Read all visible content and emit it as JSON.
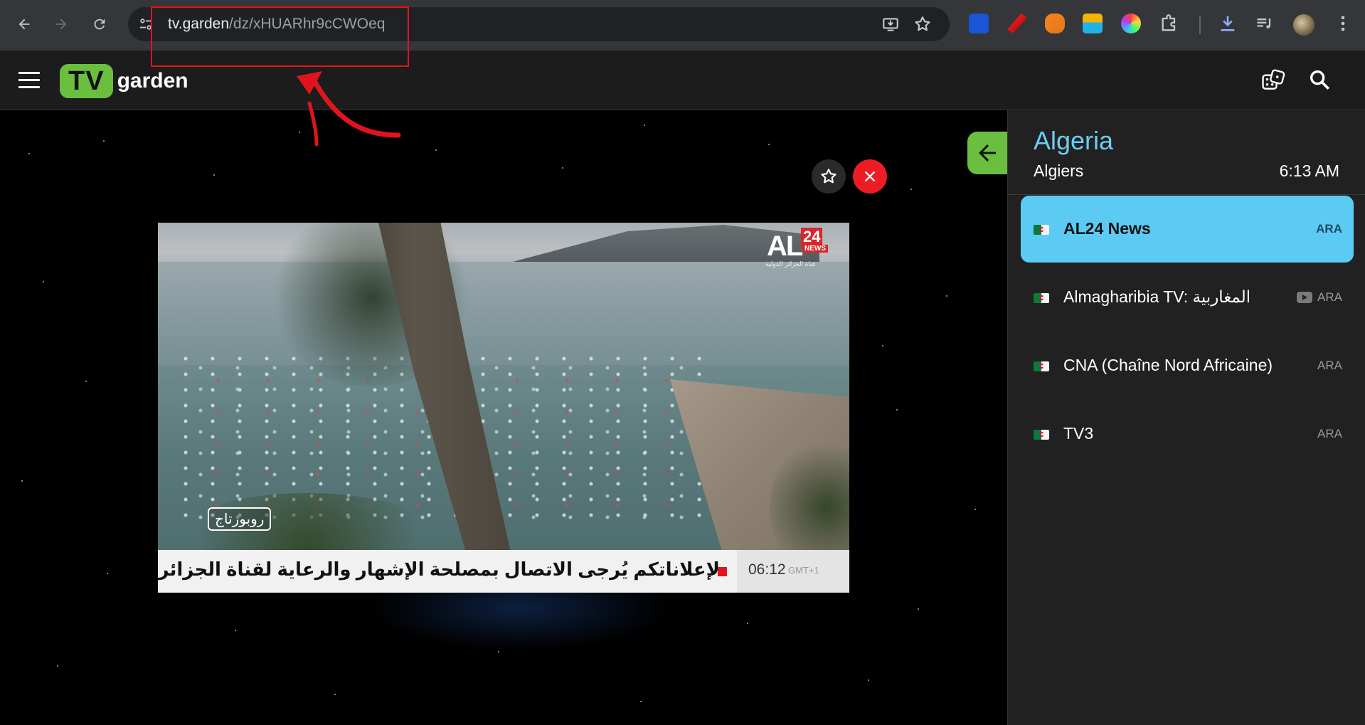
{
  "browser": {
    "url_host": "tv.garden",
    "url_path": "/dz/xHUARhr9cCWOeq"
  },
  "app": {
    "logo_tv": "TV",
    "logo_garden": "garden"
  },
  "player": {
    "channel_logo_al": "AL",
    "channel_logo_num": "24",
    "channel_logo_news": "NEWS",
    "channel_logo_sub": "قناة الجزائر الدولية",
    "segment_tag": "روبورتاج",
    "ticker_message": "لإعلاناتكم يُرجى الاتصال بمصلحة الإشهار والرعاية لقناة الجزائر الدولية",
    "ticker_time": "06:12",
    "ticker_tz": "GMT+1"
  },
  "sidebar": {
    "country": "Algeria",
    "city": "Algiers",
    "local_time": "6:13 AM",
    "channels": [
      {
        "name": "AL24 News",
        "lang": "ARA",
        "active": true
      },
      {
        "name": "Almagharibia TV: المغاربية",
        "lang": "ARA",
        "youtube": true
      },
      {
        "name": "CNA (Chaîne Nord Africaine)",
        "lang": "ARA"
      },
      {
        "name": "TV3",
        "lang": "ARA"
      }
    ]
  },
  "colors": {
    "brand_green": "#6abf3f",
    "accent_blue": "#5ccbf4",
    "close_red": "#ee1c24",
    "annotation_red": "#e0141e"
  },
  "icons": [
    "back-arrow-icon",
    "forward-arrow-icon",
    "reload-icon",
    "site-info-icon",
    "install-app-icon",
    "bookmark-star-icon",
    "download-icon",
    "media-control-icon",
    "kebab-menu-icon",
    "hamburger-icon",
    "dice-icon",
    "search-icon",
    "favorite-star-icon",
    "close-icon",
    "arrow-left-icon",
    "youtube-icon"
  ]
}
